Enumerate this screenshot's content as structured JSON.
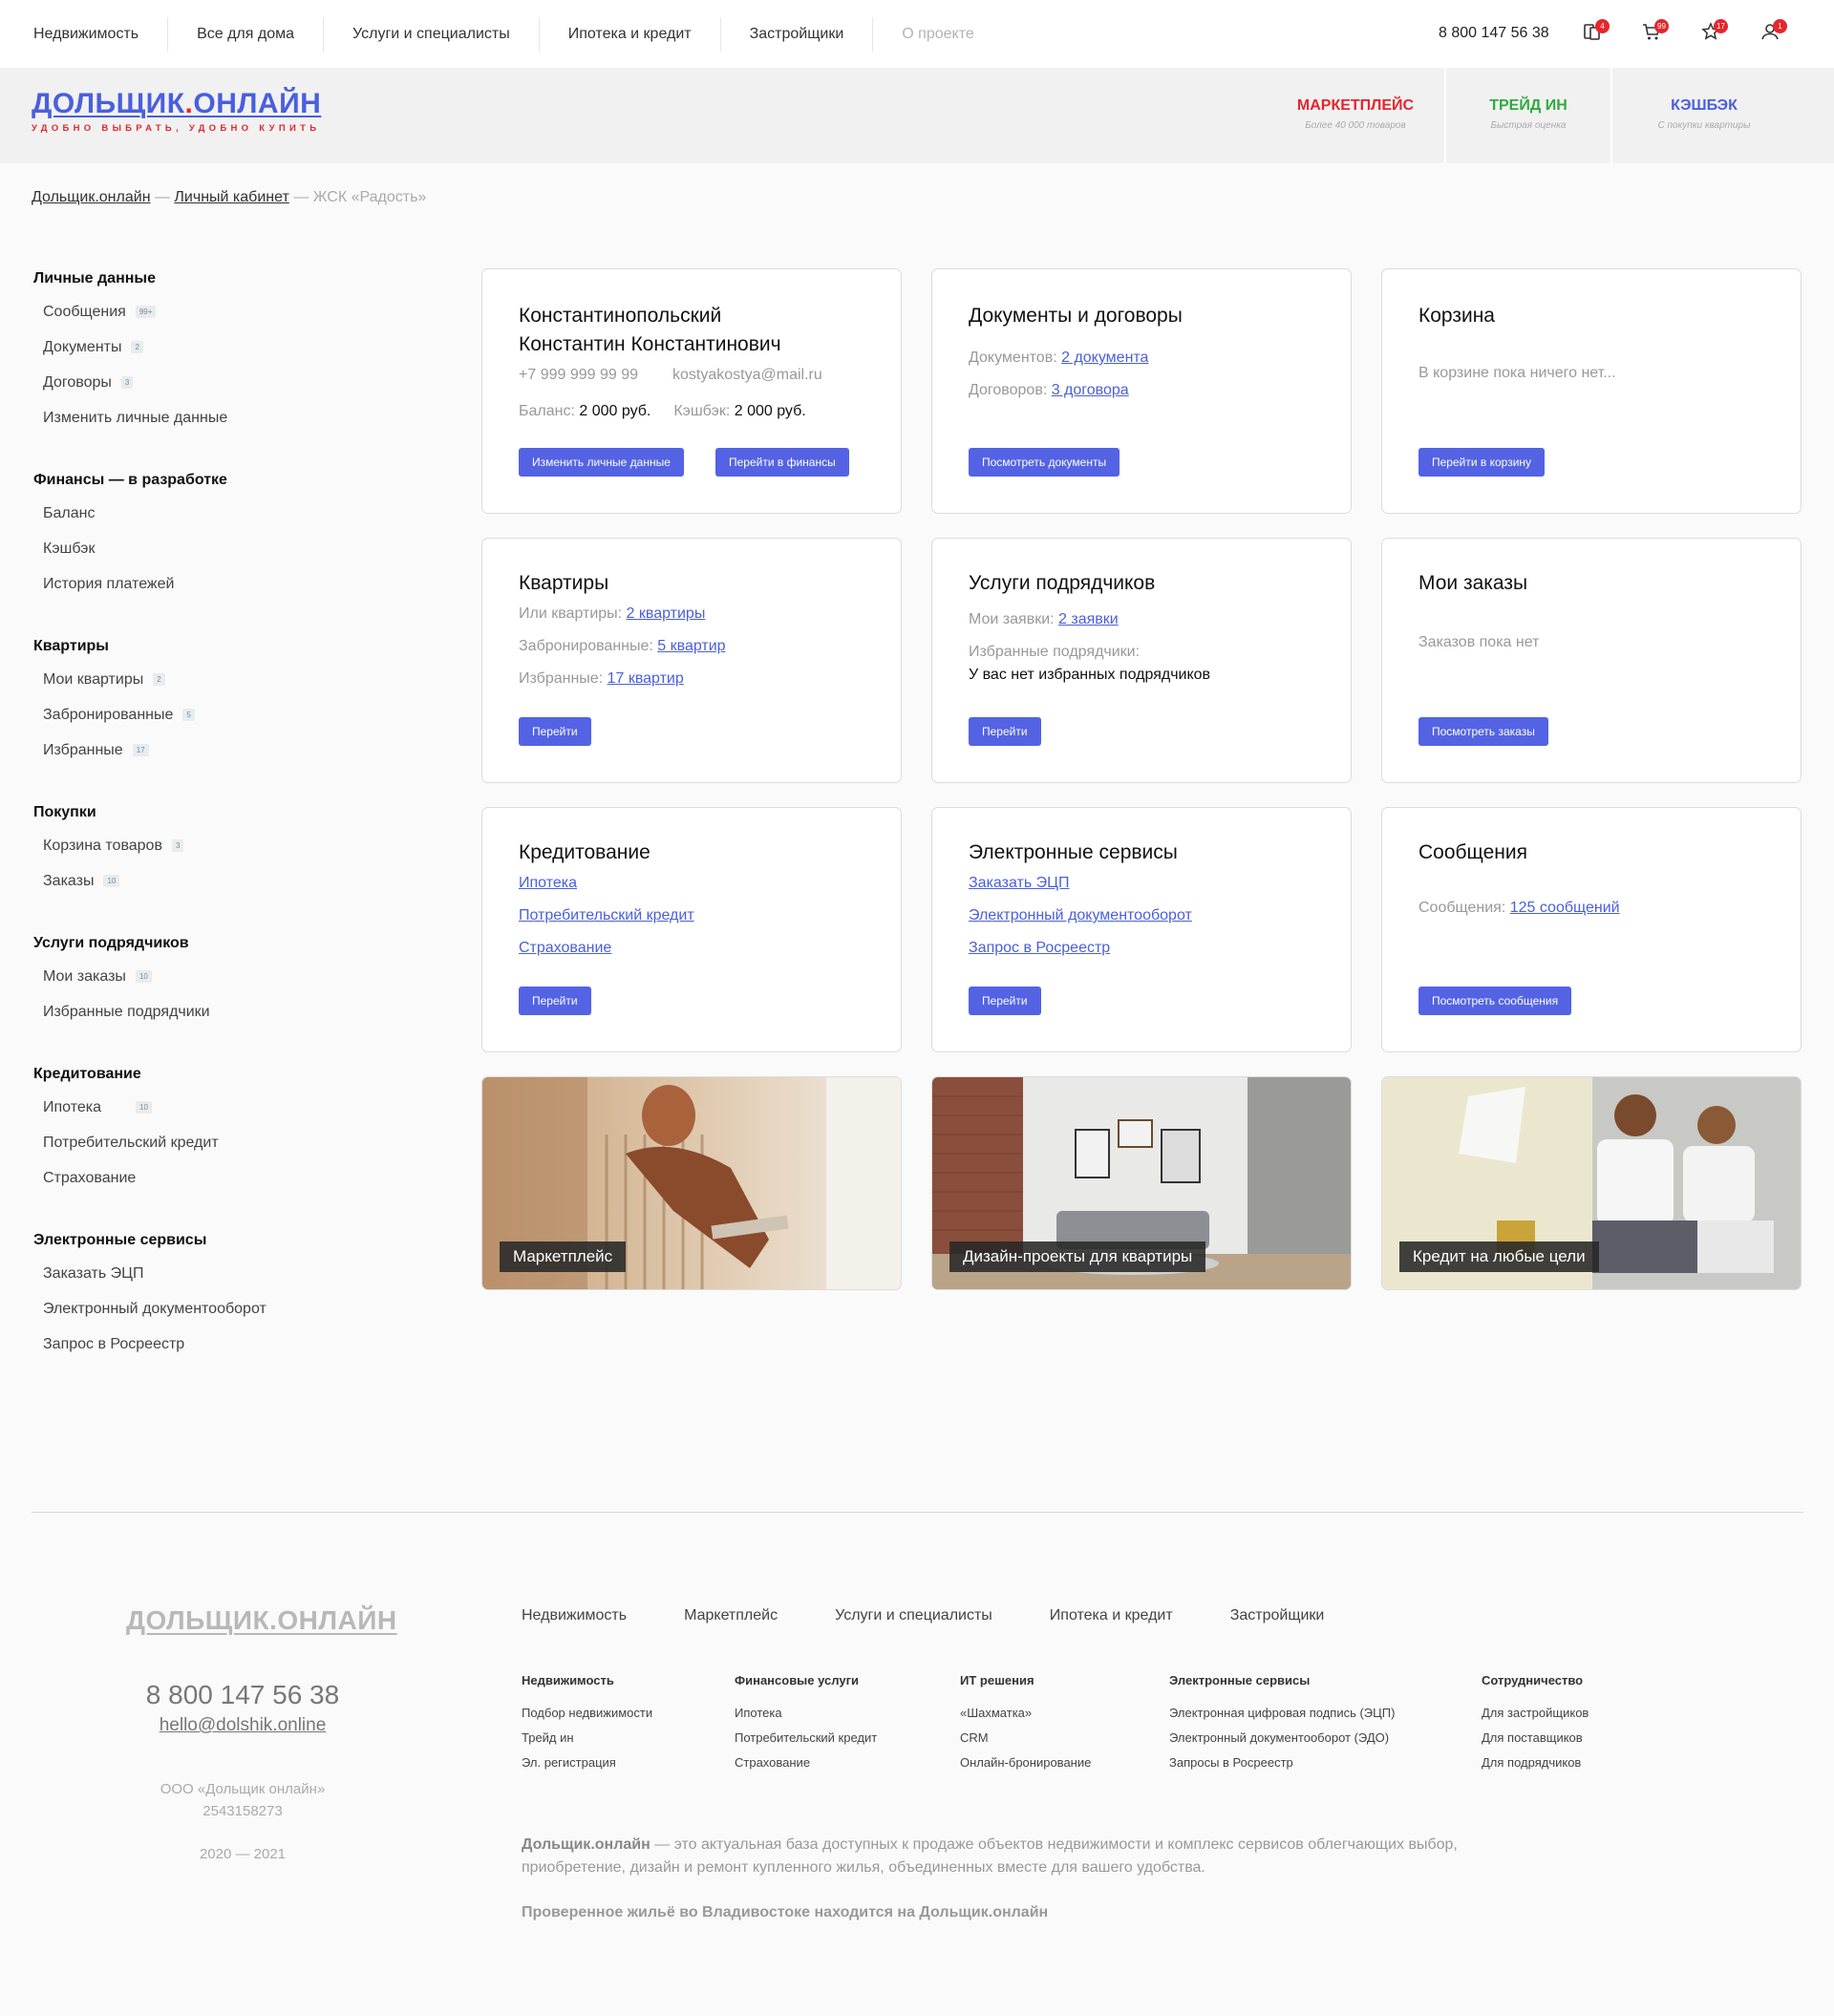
{
  "topnav": {
    "items": [
      "Недвижимость",
      "Все для дома",
      "Услуги и специалисты",
      "Ипотека и кредит",
      "Застройщики",
      "О проекте"
    ],
    "phone": "8 800 147 56 38",
    "badges": {
      "compare": "4",
      "cart": "99",
      "favorites": "17",
      "profile": "1"
    }
  },
  "header": {
    "logo_left": "ДОЛЬЩИК",
    "logo_dot": ".",
    "logo_right": "ОНЛАЙН",
    "tagline": "УДОБНО ВЫБРАТЬ, УДОБНО КУПИТЬ",
    "promos": [
      {
        "title": "МАРКЕТПЛЕЙС",
        "subtitle": "Более 40 000 товаров",
        "color": "#e5262e"
      },
      {
        "title": "ТРЕЙД ИН",
        "subtitle": "Быстрая оценка",
        "color": "#2faa3f"
      },
      {
        "title": "КЭШБЭК",
        "subtitle": "С покупки квартиры",
        "color": "#4a5fdc"
      }
    ]
  },
  "breadcrumb": {
    "home": "Дольщик.онлайн",
    "sep": " — ",
    "cabinet": "Личный кабинет",
    "current": "ЖСК «Радость»"
  },
  "sidebar": {
    "groups": [
      {
        "title": "Личные данные",
        "items": [
          {
            "label": "Сообщения",
            "count": "99+"
          },
          {
            "label": "Документы",
            "count": "2"
          },
          {
            "label": "Договоры",
            "count": "3"
          },
          {
            "label": "Изменить личные данные",
            "count": ""
          }
        ]
      },
      {
        "title": "Финансы — в разработке",
        "items": [
          {
            "label": "Баланс",
            "count": ""
          },
          {
            "label": "Кэшбэк",
            "count": ""
          },
          {
            "label": "История платежей",
            "count": ""
          }
        ]
      },
      {
        "title": "Квартиры",
        "items": [
          {
            "label": "Мои квартиры",
            "count": "2"
          },
          {
            "label": "Забронированные",
            "count": "5"
          },
          {
            "label": "Избранные",
            "count": "17"
          }
        ]
      },
      {
        "title": "Покупки",
        "items": [
          {
            "label": "Корзина товаров",
            "count": "3"
          },
          {
            "label": "Заказы",
            "count": "10"
          }
        ]
      },
      {
        "title": "Услуги подрядчиков",
        "items": [
          {
            "label": "Мои заказы",
            "count": "10"
          },
          {
            "label": "Избранные подрядчики",
            "count": ""
          }
        ]
      },
      {
        "title": "Кредитование",
        "items": [
          {
            "label": "Ипотека",
            "count": "10"
          },
          {
            "label": "Потребительский кредит",
            "count": ""
          },
          {
            "label": "Страхование",
            "count": ""
          }
        ]
      },
      {
        "title": "Электронные сервисы",
        "items": [
          {
            "label": "Заказать ЭЦП",
            "count": ""
          },
          {
            "label": "Электронный документооборот",
            "count": ""
          },
          {
            "label": "Запрос в Росреестр",
            "count": ""
          }
        ]
      }
    ]
  },
  "cards": {
    "profile": {
      "name_line1": "Константинопольский",
      "name_line2": "Константин Константинович",
      "phone": "+7 999 999 99 99",
      "email": "kostyakostya@mail.ru",
      "balance_label": "Баланс: ",
      "balance_value": "2 000 руб.",
      "cashback_label": "Кэшбэк: ",
      "cashback_value": "2 000 руб.",
      "btn_edit": "Изменить личные данные",
      "btn_finance": "Перейти в финансы"
    },
    "documents": {
      "title": "Документы и договоры",
      "docs_label": "Документов: ",
      "docs_link": "2 документа",
      "contracts_label": "Договоров: ",
      "contracts_link": "3 договора",
      "btn": "Посмотреть документы"
    },
    "cart": {
      "title": "Корзина",
      "empty": "В корзине пока ничего нет...",
      "btn": "Перейти в корзину"
    },
    "flats": {
      "title": "Квартиры",
      "mine_label": "Или квартиры: ",
      "mine_link": "2 квартиры",
      "booked_label": "Забронированные: ",
      "booked_link": "5 квартир",
      "fav_label": "Избранные: ",
      "fav_link": "17 квартир",
      "btn": "Перейти"
    },
    "contractors": {
      "title": "Услуги подрядчиков",
      "req_label": "Мои заявки: ",
      "req_link": "2 заявки",
      "fav_label": "Избранные подрядчики:",
      "fav_value": "У вас нет избранных подрядчиков",
      "btn": "Перейти"
    },
    "orders": {
      "title": "Мои заказы",
      "empty": "Заказов пока нет",
      "btn": "Посмотреть заказы"
    },
    "credit": {
      "title": "Кредитование",
      "link1": "Ипотека",
      "link2": "Потребительский кредит",
      "link3": "Страхование",
      "btn": "Перейти"
    },
    "eservices": {
      "title": "Электронные сервисы",
      "link1": "Заказать ЭЦП",
      "link2": "Электронный документооборот",
      "link3": "Запрос в Росреестр",
      "btn": "Перейти"
    },
    "messages": {
      "title": "Сообщения",
      "label": "Сообщения: ",
      "link": "125 сообщений",
      "btn": "Посмотреть сообщения"
    },
    "images": [
      {
        "caption": "Маркетплейс"
      },
      {
        "caption": "Дизайн-проекты для квартиры"
      },
      {
        "caption": "Кредит на любые цели"
      }
    ]
  },
  "footer": {
    "logo": "ДОЛЬЩИК.ОНЛАЙН",
    "phone": "8 800 147 56 38",
    "email": "hello@dolshik.online",
    "org": "ООО «Дольщик онлайн»",
    "inn": "2543158273",
    "years": "2020 — 2021",
    "nav": [
      "Недвижимость",
      "Маркетплейс",
      "Услуги и специалисты",
      "Ипотека и кредит",
      "Застройщики"
    ],
    "columns": [
      {
        "title": "Недвижимость",
        "items": [
          "Подбор недвижимости",
          "Трейд ин",
          "Эл. регистрация"
        ]
      },
      {
        "title": "Финансовые услуги",
        "items": [
          "Ипотека",
          "Потребительский кредит",
          "Страхование"
        ]
      },
      {
        "title": "ИТ решения",
        "items": [
          "«Шахматка»",
          "CRM",
          "Онлайн-бронирование"
        ]
      },
      {
        "title": "Электронные сервисы",
        "items": [
          "Электронная цифровая подпись (ЭЦП)",
          "Электронный документооборот (ЭДО)",
          "Запросы в Росреестр"
        ]
      },
      {
        "title": "Сотрудничество",
        "items": [
          "Для застройщиков",
          "Для поставщиков",
          "Для подрядчиков"
        ]
      }
    ],
    "about_brand": "Дольщик.онлайн",
    "about_text": " — это актуальная база доступных к продаже объектов недвижимости и комплекс сервисов облегчающих выбор, приобретение, дизайн и ремонт купленного жилья, объединенных вместе для вашего удобства.",
    "slogan": "Проверенное жильё во Владивостоке находится на Дольщик.онлайн"
  }
}
